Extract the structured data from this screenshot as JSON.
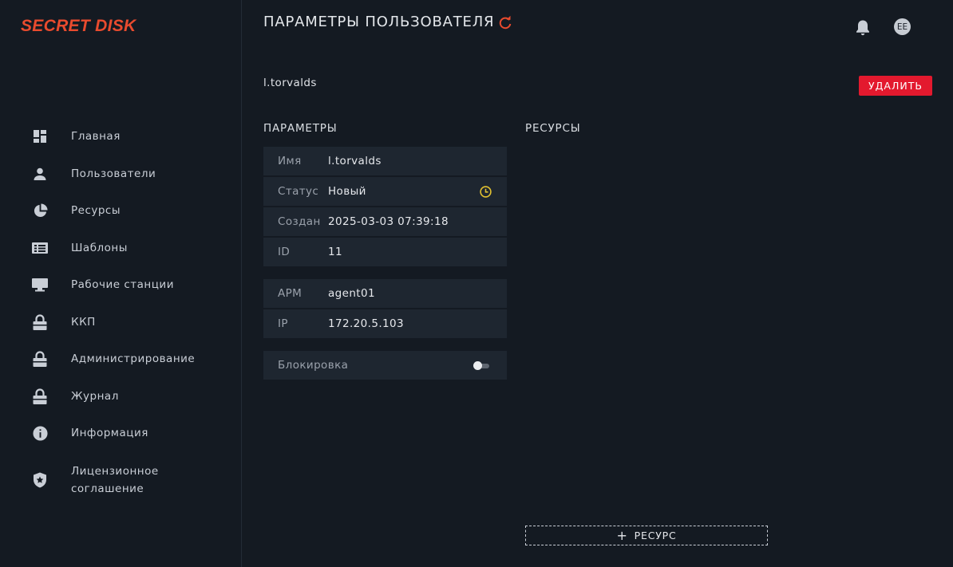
{
  "app": {
    "logo": "SECRET DISK",
    "accent": "#e94b2e",
    "danger": "#e3192e"
  },
  "sidebar": {
    "items": [
      {
        "label": "Главная",
        "icon": "dashboard-icon"
      },
      {
        "label": "Пользователи",
        "icon": "person-icon"
      },
      {
        "label": "Ресурсы",
        "icon": "pie-chart-icon"
      },
      {
        "label": "Шаблоны",
        "icon": "template-icon"
      },
      {
        "label": "Рабочие станции",
        "icon": "monitor-icon"
      },
      {
        "label": "ККП",
        "icon": "lock-icon"
      },
      {
        "label": "Администрирование",
        "icon": "lock-icon"
      },
      {
        "label": "Журнал",
        "icon": "lock-icon"
      },
      {
        "label": "Информация",
        "icon": "info-icon"
      },
      {
        "label": "Лицензионное соглашение",
        "icon": "shield-icon"
      }
    ]
  },
  "header": {
    "title": "ПАРАМЕТРЫ ПОЛЬЗОВАТЕЛЯ",
    "avatar_initials": "EE"
  },
  "user": {
    "login": "l.torvalds",
    "delete_label": "УДАЛИТЬ"
  },
  "params": {
    "title": "ПАРАМЕТРЫ",
    "name_label": "Имя",
    "name_value": "l.torvalds",
    "status_label": "Статус",
    "status_value": "Новый",
    "status_icon_color": "#e3c230",
    "created_label": "Создан",
    "created_value": "2025-03-03 07:39:18",
    "id_label": "ID",
    "id_value": "11",
    "arm_label": "АРМ",
    "arm_value": "agent01",
    "ip_label": "IP",
    "ip_value": "172.20.5.103",
    "lock_label": "Блокировка",
    "lock_enabled": false
  },
  "resources": {
    "title": "РЕСУРСЫ",
    "add_label": "РЕСУРС"
  }
}
